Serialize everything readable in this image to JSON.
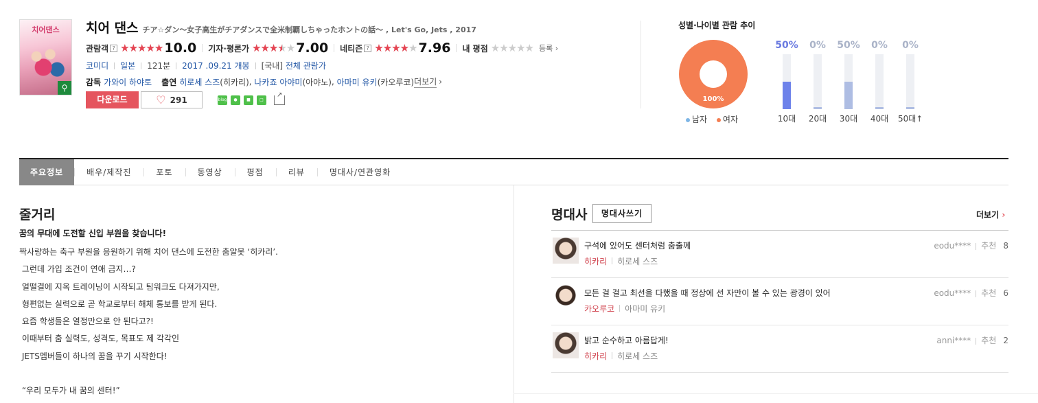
{
  "movie": {
    "title": "치어 댄스",
    "subtitle": "チア☆ダン～女子高生がチアダンスで全米制覇しちゃったホントの話～ , Let's Go, Jets , 2017",
    "poster_title": "치어댄스",
    "ratings": {
      "audience": {
        "label": "관람객",
        "score": "10.0",
        "fill": 1.0
      },
      "critic": {
        "label": "기자·평론가",
        "score": "7.00",
        "fill": 0.7
      },
      "netizen": {
        "label": "네티즌",
        "score": "7.96",
        "fill": 0.8
      },
      "mine": {
        "label": "내 평점",
        "fill": 0.0,
        "register": "등록"
      }
    },
    "genre": "코미디",
    "country": "일본",
    "runtime": "121분",
    "release": "2017 .09.21 개봉",
    "grade_prefix": "[국내]",
    "grade": "전체 관람가",
    "director_label": "감독",
    "director": "가와이 하야토",
    "cast_label": "출연",
    "cast": [
      {
        "name": "히로세 스즈",
        "role": "(히카리)"
      },
      {
        "name": "나카죠 아야미",
        "role": "(아야노)"
      },
      {
        "name": "아마미 유키",
        "role": "(카오루코)"
      }
    ],
    "more": "더보기"
  },
  "buttons": {
    "download": "다운로드",
    "likes": "291"
  },
  "share_icons": [
    "blog-icon",
    "band-icon",
    "bookmark-icon",
    "line-icon"
  ],
  "stats": {
    "title": "성별·나이별 관람 추이",
    "female_pct_label": "100%",
    "legend": [
      {
        "label": "남자",
        "color": "#7eb6e6"
      },
      {
        "label": "여자",
        "color": "#f47e52"
      }
    ],
    "ages": [
      {
        "label": "10대",
        "pct": "50%",
        "value": 0.5,
        "highlight": true
      },
      {
        "label": "20대",
        "pct": "0%",
        "value": 0.0,
        "highlight": false
      },
      {
        "label": "30대",
        "pct": "50%",
        "value": 0.5,
        "highlight": false
      },
      {
        "label": "40대",
        "pct": "0%",
        "value": 0.0,
        "highlight": false
      },
      {
        "label": "50대↑",
        "pct": "0%",
        "value": 0.0,
        "highlight": false
      }
    ]
  },
  "tabs": [
    "주요정보",
    "배우/제작진",
    "포토",
    "동영상",
    "평점",
    "리뷰",
    "명대사/연관영화"
  ],
  "synopsis": {
    "heading": "줄거리",
    "subheading": "꿈의 무대에 도전할 신입 부원을 찾습니다!",
    "body": "짝사랑하는 축구 부원을 응원하기 위해 치어 댄스에 도전한 춤알못 ‘히카리’.\n 그런데 가입 조건이 연애 금지…?\n 얼떨결에 지옥 트레이닝이 시작되고 팀워크도 다져가지만,\n 형편없는 실력으로 곧 학교로부터 해체 통보를 받게 된다.\n 요즘 학생들은 열정만으로 안 된다고?!\n 이때부터 춤 실력도, 성격도, 목표도 제 각각인\n JETS멤버들이 하나의 꿈을 꾸기 시작한다!\n\n “우리 모두가 내 꿈의 센터!”"
  },
  "quotes": {
    "heading": "명대사",
    "write": "명대사쓰기",
    "more": "더보기",
    "items": [
      {
        "text": "구석에 있어도 센터처럼 춤출께",
        "character": "히카리",
        "actor": "히로세 스즈",
        "user": "eodu****",
        "rec_label": "추천",
        "rec": "8"
      },
      {
        "text": "모든 걸 걸고 최선을 다했을 때 정상에 선 자만이 볼 수 있는 광경이 있어",
        "character": "카오루코",
        "actor": "아마미 유키",
        "user": "eodu****",
        "rec_label": "추천",
        "rec": "6"
      },
      {
        "text": "밝고 순수하고 아름답게!",
        "character": "히카리",
        "actor": "히로세 스즈",
        "user": "anni****",
        "rec_label": "추천",
        "rec": "2"
      }
    ]
  }
}
